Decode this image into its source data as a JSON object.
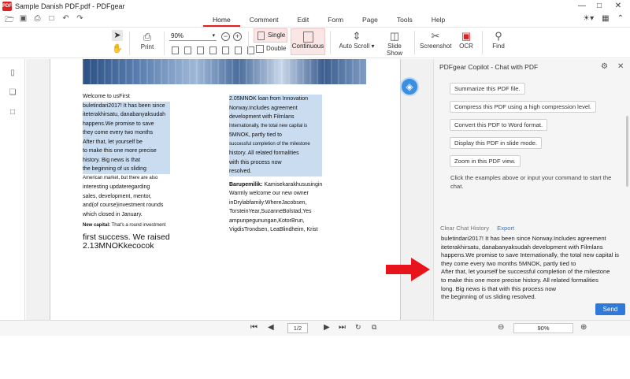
{
  "window": {
    "title": "Sample Danish PDF.pdf - PDFgear",
    "logo": "PDF"
  },
  "menu": [
    "Home",
    "Comment",
    "Edit",
    "Form",
    "Page",
    "Tools",
    "Help"
  ],
  "ribbon": {
    "print": "Print",
    "zoom_value": "90%",
    "single": "Single",
    "double": "Double",
    "continuous": "Continuous",
    "auto_scroll": "Auto Scroll",
    "slide_show": "Slide Show",
    "screenshot": "Screenshot",
    "ocr": "OCR",
    "find": "Find"
  },
  "document": {
    "left_col": [
      "Welcome to usFirst",
      "buletindari2017! It has been since",
      "iteterakhirsatu, danabanyaksudah",
      "happens.We promise to save",
      "they come every two months",
      "After that, let yourself be",
      "to make this one more precise",
      "history. Big news is that",
      "the beginning of us sliding",
      "American market, but there are also",
      "interesting updateregarding",
      "sales, development, mentor,",
      "and(of course)investment rounds",
      "which closed in January."
    ],
    "new_capital_label": "New capital:",
    "new_capital_text": "That's a round investment",
    "big_line1": "first success. We raised",
    "big_line2": "2.13MNOKkecocok",
    "right_col": [
      "2.05MNOK loan from Innovation",
      "Norway.Includes agreement",
      "development with Filmlans",
      "Internationally, the total new capital is",
      "5MNOK, partly tied to",
      "successful completion of the milestone",
      "history. All related formalities",
      "with this process now",
      "resolved."
    ],
    "barupemilik_label": "Barupemilik:",
    "barupemilik_text": "Kamisekarakhususingin",
    "right_col2": [
      "Warmly welcome our new owner",
      "inDrylabfamily:WhereJacobsen,",
      "TorsteinYear,SuzanneBolstad,Yes",
      "ampunpegunungan,KotorBrun,",
      "VigdisTrondsen, LeaBlindheim, Krist"
    ]
  },
  "chat": {
    "title": "PDFgear Copilot - Chat with PDF",
    "examples": [
      "Summarize this PDF file.",
      "Compress this PDF using a high compression level.",
      "Convert this PDF to Word format.",
      "Display this PDF in slide mode.",
      "Zoom in this PDF view."
    ],
    "note": "Click the examples above or input your command to start the chat.",
    "clear": "Clear Chat History",
    "export": "Export",
    "input_lines": [
      "buletindari2017! It has been since Norway.Includes agreement",
      "iteterakhirsatu, danabanyaksudah development with Filmlans",
      "happens.We promise to save Internationally, the total new capital is",
      "they come every two months 5MNOK, partly tied to",
      "After that, let yourself be successful completion of the milestone",
      "to make this one more precise history. All related formalities",
      "long. Big news is that with this process now",
      "the beginning of us sliding resolved."
    ],
    "send": "Send"
  },
  "status": {
    "page": "1/2",
    "zoom": "90%"
  },
  "colors": {
    "accent": "#e02020",
    "link": "#2f7ad8",
    "highlight": "#c9dcf0",
    "arrow": "#e8141c"
  }
}
